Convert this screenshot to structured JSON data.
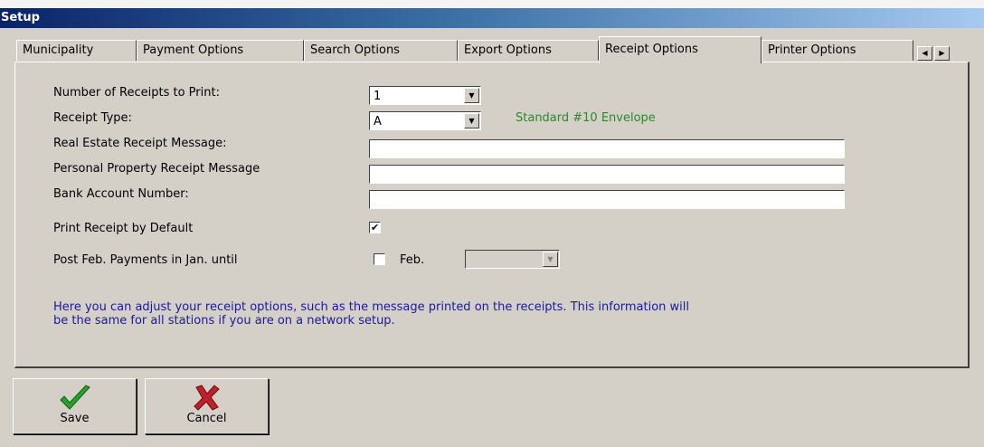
{
  "window": {
    "title": "Setup"
  },
  "tabs": [
    {
      "label": "Municipality"
    },
    {
      "label": "Payment Options"
    },
    {
      "label": "Search Options"
    },
    {
      "label": "Export Options"
    },
    {
      "label": "Receipt Options"
    },
    {
      "label": "Printer Options"
    }
  ],
  "active_tab": "Receipt Options",
  "tab_scroll": {
    "left_icon": "arrow-left-icon",
    "right_icon": "arrow-right-icon"
  },
  "form": {
    "num_receipts_label": "Number of Receipts to Print:",
    "num_receipts_value": "1",
    "receipt_type_label": "Receipt Type:",
    "receipt_type_value": "A",
    "receipt_type_note": "Standard #10 Envelope",
    "real_estate_label": "Real Estate Receipt Message:",
    "real_estate_value": "",
    "personal_property_label": "Personal Property Receipt Message",
    "personal_property_value": "",
    "bank_account_label": "Bank Account Number:",
    "bank_account_value": "",
    "print_default_label": "Print Receipt by Default",
    "print_default_checked": true,
    "print_default_mark": "✔",
    "post_feb_label": "Post Feb. Payments in Jan. until",
    "post_feb_checked": false,
    "feb_label": "Feb.",
    "feb_value": ""
  },
  "info_text": "Here you can adjust your receipt options, such as the message printed on the receipts.  This information will be the same for all stations if you are on a network setup.",
  "buttons": {
    "save": "Save",
    "cancel": "Cancel"
  },
  "colors": {
    "title_bar": "#0a246a",
    "note_green": "#2a8a2a",
    "info_blue": "#1a1a9a",
    "save_icon": "#2ca02c",
    "cancel_icon": "#c0202a"
  }
}
